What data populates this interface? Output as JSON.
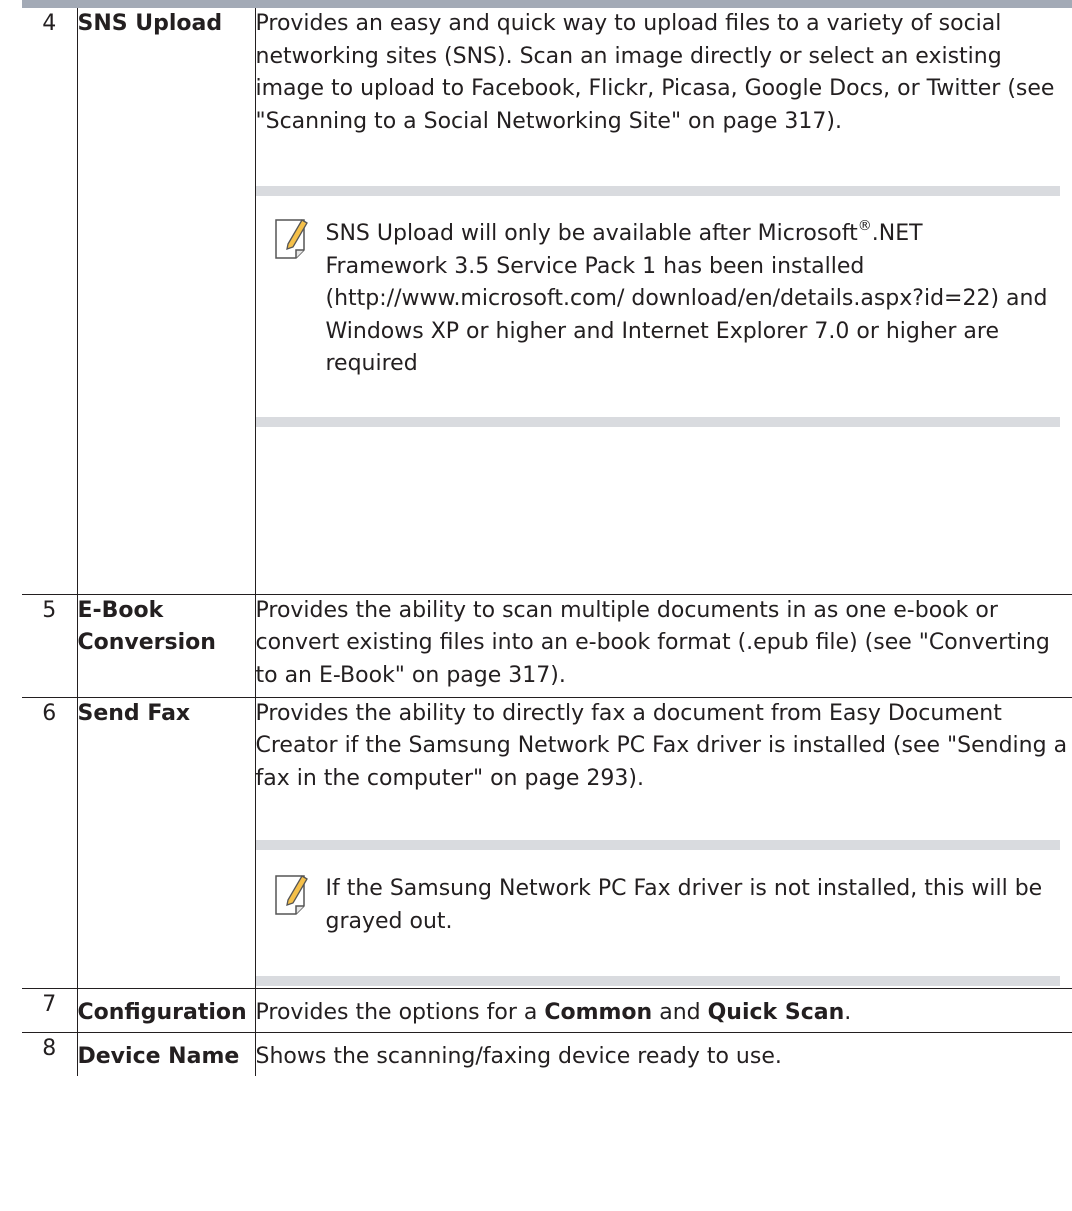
{
  "rows": [
    {
      "num": "4",
      "name": "SNS Upload",
      "desc": "Provides an easy and quick way to upload files to a variety of social networking sites (SNS). Scan an image directly or select an existing image to upload to Facebook, Flickr, Picasa, Google Docs, or Twitter (see \"Scanning to a Social Networking Site\" on page 317).",
      "note_icon": "note-pencil-icon",
      "note_prefix": "SNS Upload will only be available after Microsoft",
      "note_reg": "®",
      "note_suffix": ".NET Framework 3.5 Service Pack 1 has been installed (http://www.microsoft.com/ download/en/details.aspx?id=22) and Windows XP or higher and Internet Explorer 7.0 or higher are required"
    },
    {
      "num": "5",
      "name_line1": "E-Book",
      "name_line2": "Conversion",
      "desc": "Provides the ability to scan multiple documents in as one e-book or convert existing files into an e-book format (.epub file) (see \"Converting to an E-Book\" on page 317)."
    },
    {
      "num": "6",
      "name": "Send Fax",
      "desc": "Provides the ability to directly fax a document from Easy Document Creator if the Samsung Network PC Fax driver is installed (see \"Sending a fax in the computer\" on page 293).",
      "note_icon": "note-pencil-icon",
      "note": "If the Samsung Network PC Fax driver is not installed, this will be grayed out."
    },
    {
      "num": "7",
      "name": "Configuration",
      "desc_a": "Provides the options for a ",
      "desc_b": "Common",
      "desc_c": " and ",
      "desc_d": "Quick Scan",
      "desc_e": "."
    },
    {
      "num": "8",
      "name": "Device Name",
      "desc": "Shows the scanning/faxing device ready to use."
    }
  ]
}
